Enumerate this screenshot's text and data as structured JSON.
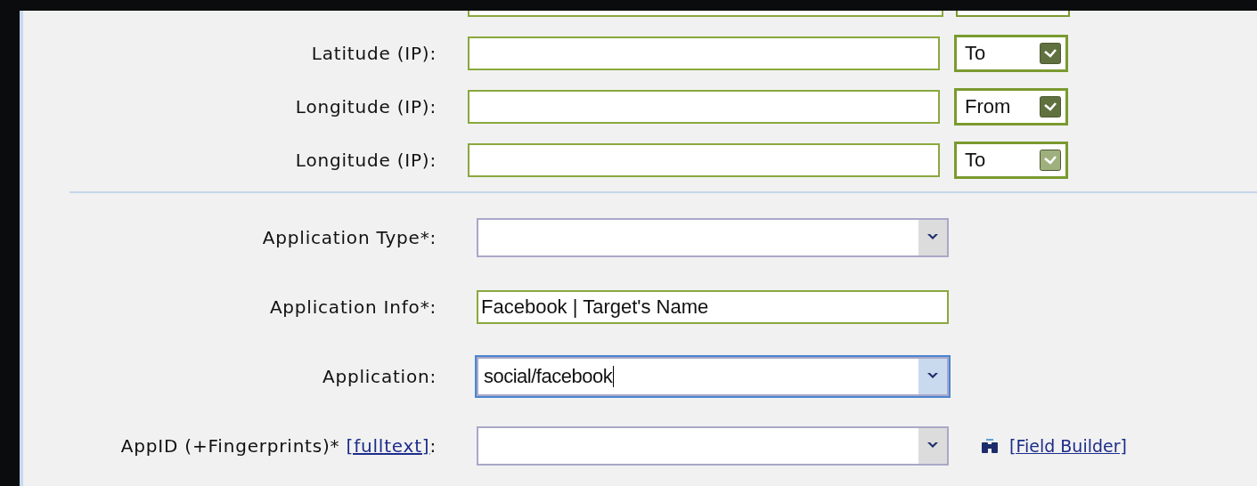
{
  "range_rows": [
    {
      "label": "Latitude (IP):",
      "value": "",
      "bound": "To",
      "disabled": false
    },
    {
      "label": "Longitude (IP):",
      "value": "",
      "bound": "From",
      "disabled": false
    },
    {
      "label": "Longitude (IP):",
      "value": "",
      "bound": "To",
      "disabled": true
    }
  ],
  "app_rows": [
    {
      "label": "Application Type*:",
      "kind": "combo",
      "focused": false,
      "valid": false,
      "value": ""
    },
    {
      "label": "Application Info*:",
      "kind": "text",
      "focused": false,
      "valid": true,
      "value": "Facebook | Target's Name"
    },
    {
      "label": "Application:",
      "kind": "combo",
      "focused": true,
      "valid": false,
      "value": "social/facebook"
    },
    {
      "label": "AppID (+Fingerprints)* ",
      "link": "[fulltext]",
      "label_after": ":",
      "kind": "combo",
      "focused": false,
      "valid": false,
      "value": "",
      "field_builder": "[Field Builder]"
    }
  ]
}
